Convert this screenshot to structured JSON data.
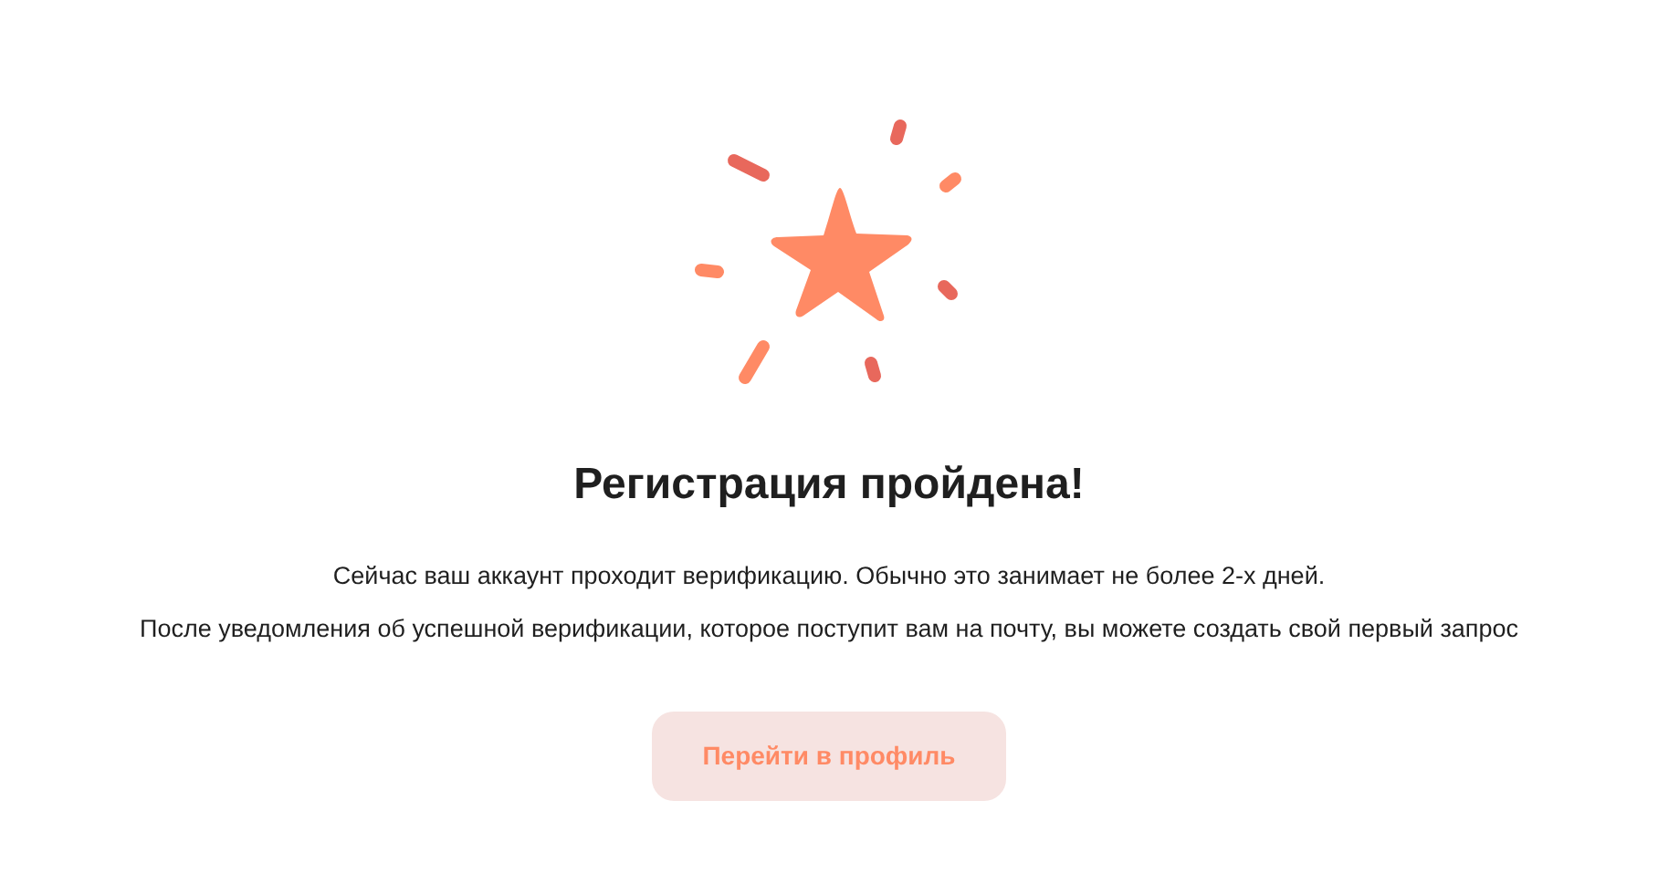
{
  "title": "Регистрация пройдена!",
  "messages": [
    "Сейчас ваш аккаунт проходит верификацию. Обычно это занимает не более 2-х дней.",
    "После уведомления об успешной верификации, которое поступит вам на почту, вы можете создать свой первый запрос"
  ],
  "button": {
    "label": "Перейти в профиль"
  }
}
